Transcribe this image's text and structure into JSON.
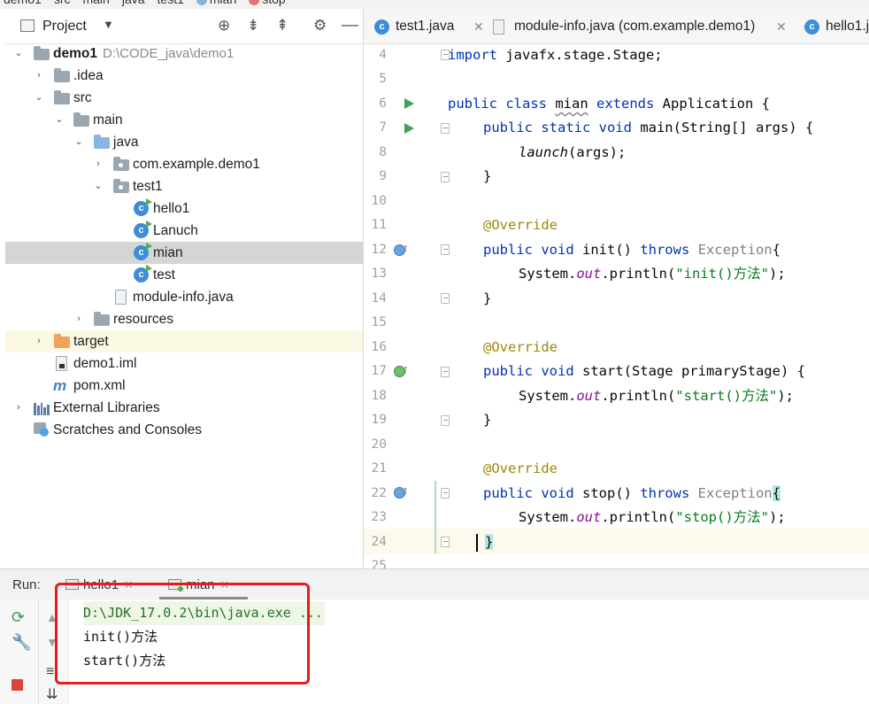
{
  "breadcrumbs": [
    "demo1",
    "src",
    "main",
    "java",
    "test1",
    "mian",
    "stop"
  ],
  "project": {
    "title": "Project",
    "tree": [
      {
        "label": "demo1",
        "path": "D:\\CODE_java\\demo1"
      },
      {
        "label": ".idea"
      },
      {
        "label": "src"
      },
      {
        "label": "main"
      },
      {
        "label": "java"
      },
      {
        "label": "com.example.demo1"
      },
      {
        "label": "test1"
      },
      {
        "label": "hello1"
      },
      {
        "label": "Lanuch"
      },
      {
        "label": "mian"
      },
      {
        "label": "test"
      },
      {
        "label": "module-info.java"
      },
      {
        "label": "resources"
      },
      {
        "label": "target"
      },
      {
        "label": "demo1.iml"
      },
      {
        "label": "pom.xml"
      },
      {
        "label": "External Libraries"
      },
      {
        "label": "Scratches and Consoles"
      }
    ]
  },
  "editor": {
    "tabs": [
      {
        "label": "test1.java"
      },
      {
        "label": "module-info.java (com.example.demo1)"
      },
      {
        "label": "hello1.j"
      }
    ],
    "line_numbers": [
      "4",
      "5",
      "6",
      "7",
      "8",
      "9",
      "10",
      "11",
      "12",
      "13",
      "14",
      "15",
      "16",
      "17",
      "18",
      "19",
      "20",
      "21",
      "22",
      "23",
      "24",
      "25"
    ],
    "code": {
      "l4_kw": "import",
      "l4_rest": " javafx.stage.Stage;",
      "l6_kw": "public class",
      "l6_name": "mian",
      "l6_kw2": "extends",
      "l6_rest": " Application {",
      "l7_kw": "public static void",
      "l7_rest": " main(String[] args) {",
      "l8_call": "launch",
      "l8_rest": "(args);",
      "brace": "}",
      "override": "@Override",
      "l12_kw": "public void",
      "l12_rest": " init() ",
      "throws": "throws",
      "exception": " Exception",
      "open_brace": "{",
      "sys": "System.",
      "out": "out",
      "println": ".println(",
      "l13_str": "\"init()方法\"",
      "close_call": ");",
      "l17_rest": " start(Stage primaryStage) {",
      "l18_str": "\"start()方法\"",
      "l22_rest": " stop() ",
      "l23_str": "\"stop()方法\""
    }
  },
  "run": {
    "label": "Run:",
    "tabs": [
      {
        "label": "hello1"
      },
      {
        "label": "mian"
      }
    ],
    "console": [
      "D:\\JDK_17.0.2\\bin\\java.exe ...",
      "init()方法",
      "start()方法"
    ]
  }
}
